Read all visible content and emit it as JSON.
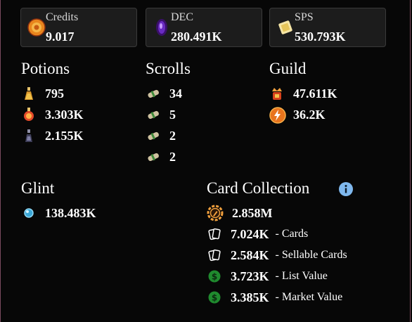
{
  "credits": {
    "label": "Credits",
    "value": "9.017"
  },
  "dec": {
    "label": "DEC",
    "value": "280.491K"
  },
  "sps": {
    "label": "SPS",
    "value": "530.793K"
  },
  "potions": {
    "title": "Potions",
    "items": [
      {
        "icon": "gold-potion-icon",
        "value": "795"
      },
      {
        "icon": "legendary-potion-icon",
        "value": "3.303K"
      },
      {
        "icon": "alchemy-potion-icon",
        "value": "2.155K"
      }
    ]
  },
  "scrolls": {
    "title": "Scrolls",
    "items": [
      {
        "icon": "scroll-icon",
        "value": "34"
      },
      {
        "icon": "scroll-icon",
        "value": "5"
      },
      {
        "icon": "scroll-icon",
        "value": "2"
      },
      {
        "icon": "scroll-icon",
        "value": "2"
      }
    ]
  },
  "guild": {
    "title": "Guild",
    "items": [
      {
        "icon": "guild-crown-icon",
        "value": "47.611K"
      },
      {
        "icon": "merit-bolt-icon",
        "value": "36.2K"
      }
    ]
  },
  "glint": {
    "title": "Glint",
    "value": "138.483K"
  },
  "card_collection": {
    "title": "Card Collection",
    "total": "2.858M",
    "rows": [
      {
        "icon": "cards-icon",
        "value": "7.024K",
        "suffix": "- Cards"
      },
      {
        "icon": "cards-icon",
        "value": "2.584K",
        "suffix": "- Sellable Cards"
      },
      {
        "icon": "dollar-icon",
        "value": "3.723K",
        "suffix": "- List Value"
      },
      {
        "icon": "dollar-icon",
        "value": "3.385K",
        "suffix": "- Market Value"
      }
    ]
  },
  "colors": {
    "background": "#070707",
    "card_bg": "#1c1c1c",
    "info_blue": "#7fb8ee",
    "dollar_green": "#1f8a2e",
    "collection_orange": "#f2a03d"
  }
}
